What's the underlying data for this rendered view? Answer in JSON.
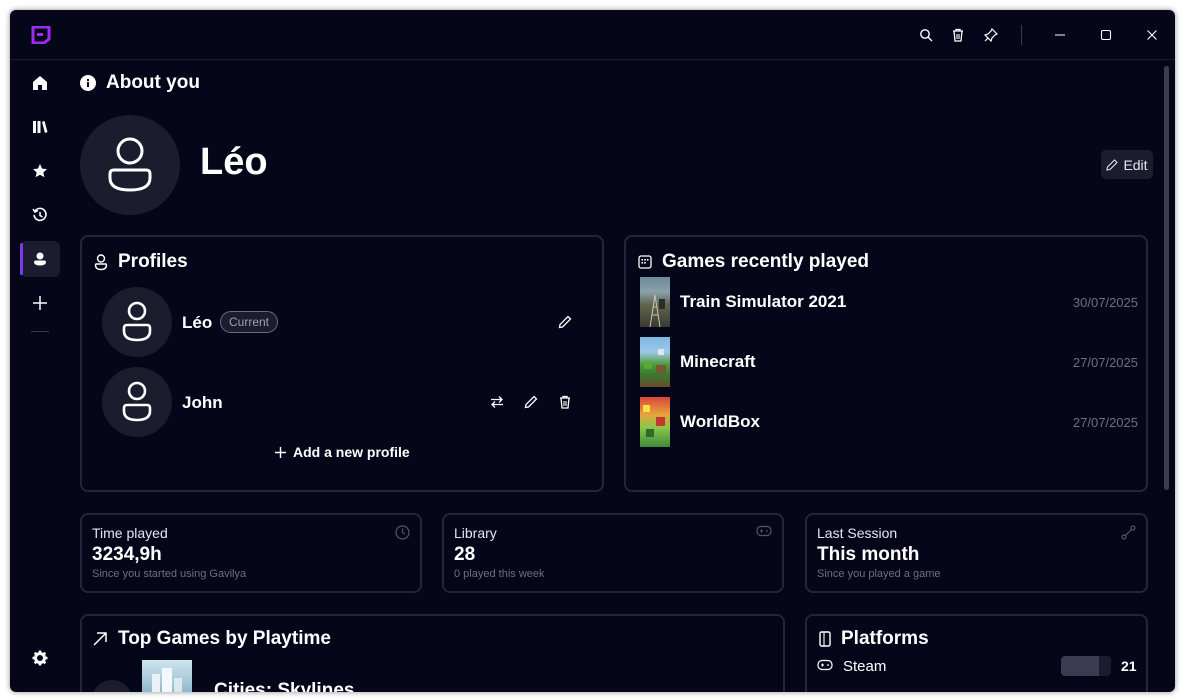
{
  "colors": {
    "background": "#06061a",
    "card_border": "#25253a",
    "accent": "#7c3aed",
    "muted": "#6e6e84"
  },
  "titlebar": {
    "logo_icon": "app-logo",
    "buttons": [
      "search-icon",
      "trash-icon",
      "pin-icon",
      "minimize-icon",
      "maximize-icon",
      "close-icon"
    ]
  },
  "sidebar": {
    "items": [
      "home-icon",
      "library-icon",
      "star-icon",
      "history-icon",
      "user-icon",
      "plus-icon"
    ],
    "active": "user-icon",
    "bottom": "gear-icon"
  },
  "about": {
    "heading": "About you",
    "user_name": "Léo",
    "edit_label": "Edit"
  },
  "profiles": {
    "title": "Profiles",
    "items": [
      {
        "name": "Léo",
        "badge": "Current"
      },
      {
        "name": "John",
        "badge": ""
      }
    ],
    "add_label": "Add a new profile"
  },
  "recent_games": {
    "title": "Games recently played",
    "items": [
      {
        "name": "Train Simulator 2021",
        "date": "30/07/2025"
      },
      {
        "name": "Minecraft",
        "date": "27/07/2025"
      },
      {
        "name": "WorldBox",
        "date": "27/07/2025"
      }
    ]
  },
  "stats": [
    {
      "label": "Time played",
      "value": "3234,9h",
      "sub": "Since you started using Gavilya",
      "icon": "clock-icon"
    },
    {
      "label": "Library",
      "value": "28",
      "sub": "0 played this week",
      "icon": "gamepad-icon"
    },
    {
      "label": "Last Session",
      "value": "This month",
      "sub": "Since you played a game",
      "icon": "route-icon"
    }
  ],
  "top_games": {
    "title": "Top Games by Playtime",
    "items": [
      {
        "name": "Cities: Skylines"
      }
    ]
  },
  "platforms": {
    "title": "Platforms",
    "items": [
      {
        "name": "Steam",
        "count": "21",
        "share": 0.75
      }
    ]
  }
}
